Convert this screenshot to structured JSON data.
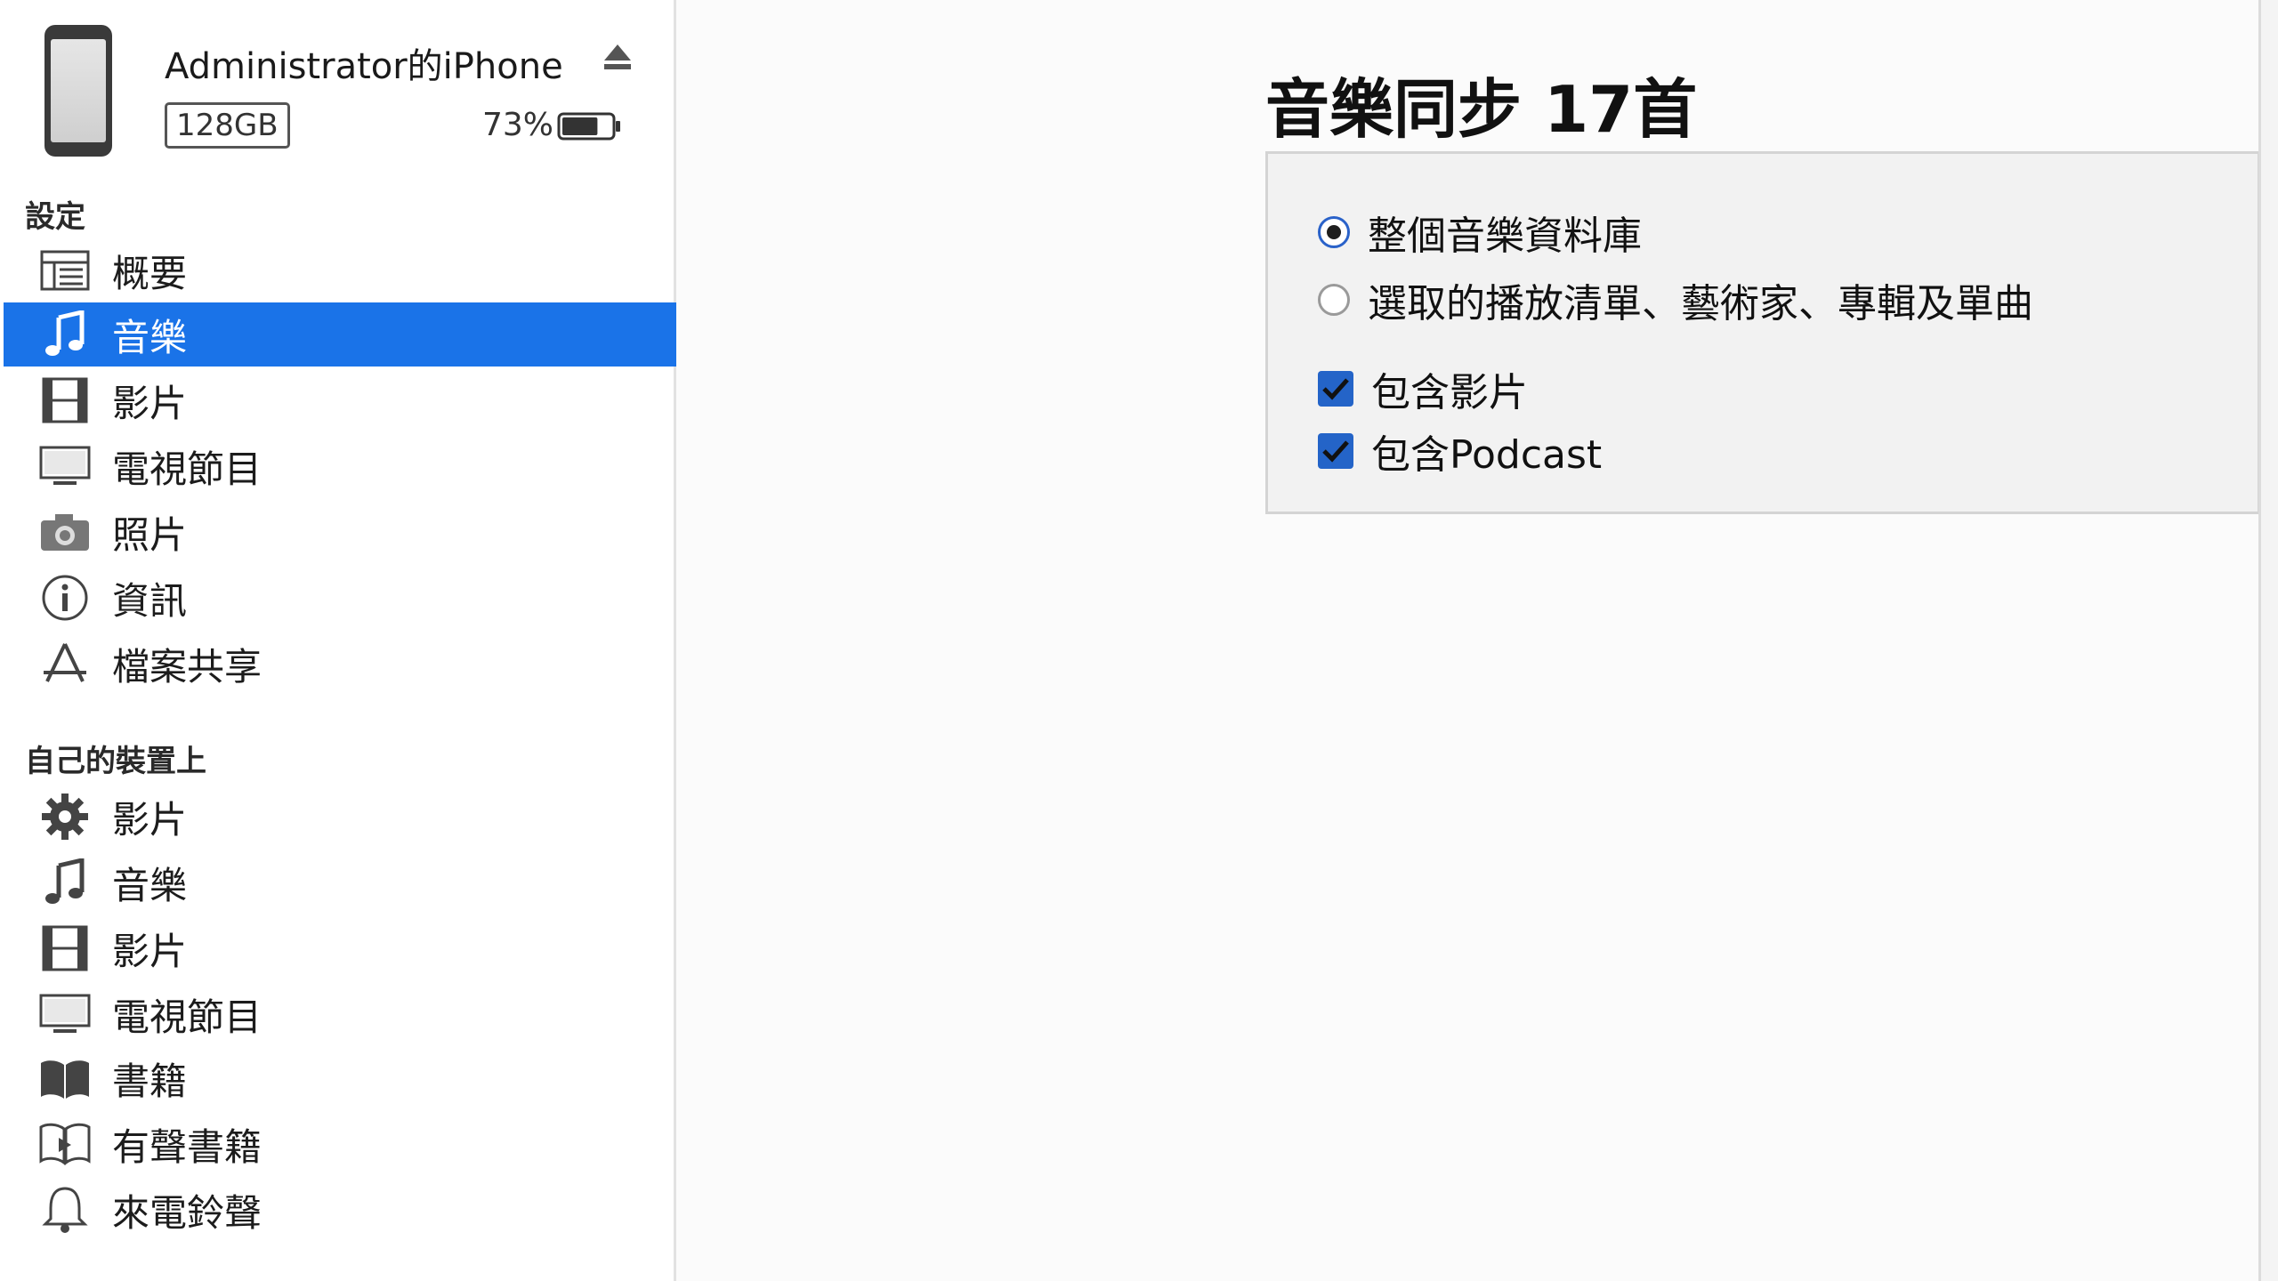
{
  "device": {
    "name": "Administrator的iPhone",
    "capacity": "128GB",
    "battery_percent": "73%",
    "battery_level": 0.73,
    "icon": "phone-icon",
    "eject_icon": "eject-icon"
  },
  "sidebar": {
    "settings_header": "設定",
    "settings_items": [
      {
        "label": "概要",
        "icon": "summary-list-icon",
        "selected": false
      },
      {
        "label": "音樂",
        "icon": "music-note-icon",
        "selected": true
      },
      {
        "label": "影片",
        "icon": "film-icon",
        "selected": false
      },
      {
        "label": "電視節目",
        "icon": "tv-icon",
        "selected": false
      },
      {
        "label": "照片",
        "icon": "camera-icon",
        "selected": false
      },
      {
        "label": "資訊",
        "icon": "info-icon",
        "selected": false
      },
      {
        "label": "檔案共享",
        "icon": "app-store-icon",
        "selected": false
      }
    ],
    "ondevice_header": "自己的裝置上",
    "ondevice_items": [
      {
        "label": "影片",
        "icon": "gear-icon"
      },
      {
        "label": "音樂",
        "icon": "music-note-icon"
      },
      {
        "label": "影片",
        "icon": "film-icon"
      },
      {
        "label": "電視節目",
        "icon": "tv-icon"
      },
      {
        "label": "書籍",
        "icon": "book-icon"
      },
      {
        "label": "有聲書籍",
        "icon": "audiobook-icon"
      },
      {
        "label": "來電鈴聲",
        "icon": "bell-icon"
      }
    ]
  },
  "main": {
    "title": "音樂同步 17首",
    "options": {
      "radio_entire": {
        "label": "整個音樂資料庫",
        "checked": true
      },
      "radio_selected": {
        "label": "選取的播放清單、藝術家、專輯及單曲",
        "checked": false
      },
      "check_videos": {
        "label": "包含影片",
        "checked": true
      },
      "check_podcast": {
        "label": "包含Podcast",
        "checked": true
      }
    }
  },
  "colors": {
    "selection": "#1a73e8",
    "checkbox": "#2464c8",
    "panel_bg": "#f2f2f2",
    "sidebar_bg": "#ffffff"
  }
}
